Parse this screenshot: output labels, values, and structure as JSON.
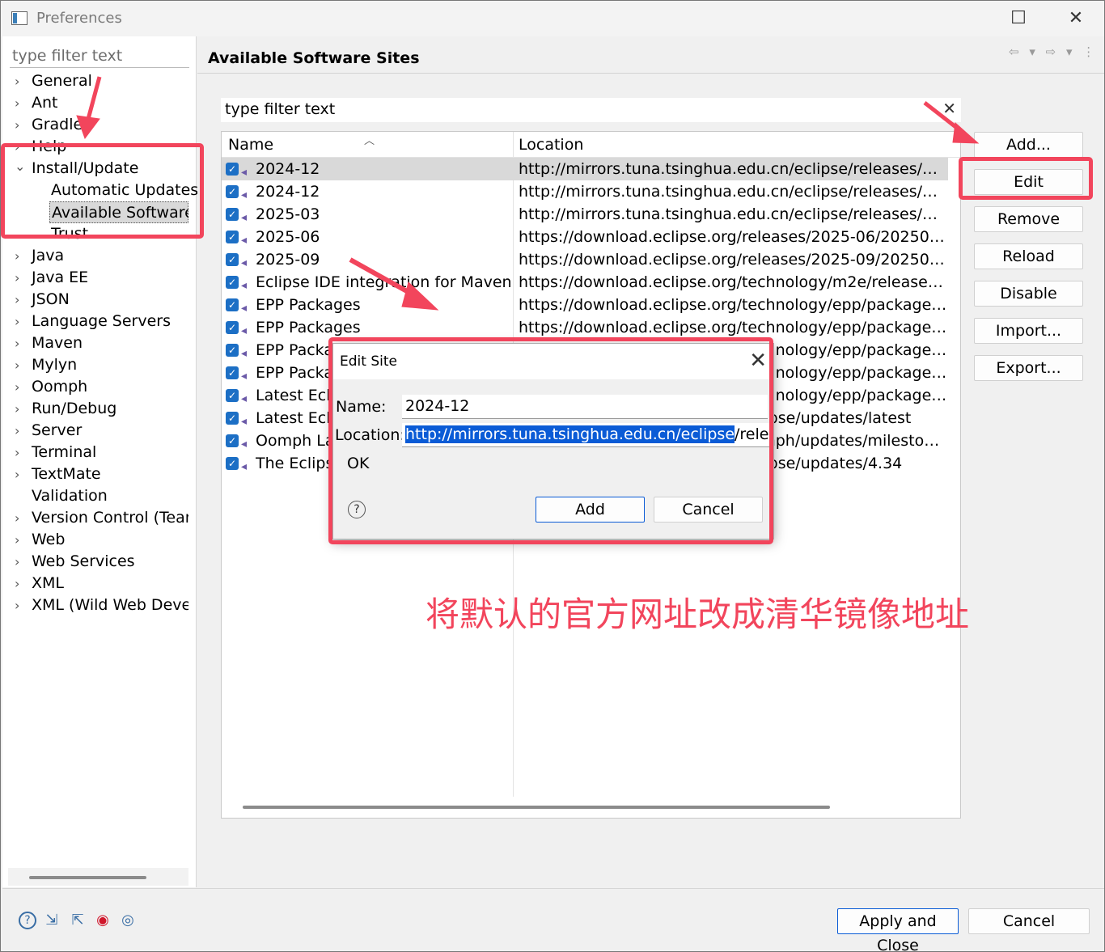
{
  "window": {
    "title": "Preferences",
    "maximize_glyph": "☐",
    "close_glyph": "✕"
  },
  "left": {
    "filter_placeholder": "type filter text",
    "tree": [
      {
        "label": "General",
        "chevron": "›"
      },
      {
        "label": "Ant",
        "chevron": "›"
      },
      {
        "label": "Gradle",
        "chevron": "›"
      },
      {
        "label": "Help",
        "chevron": "›"
      },
      {
        "label": "Install/Update",
        "chevron": "⌄"
      },
      {
        "label": "Automatic Updates",
        "chevron": ""
      },
      {
        "label": "Available Software Sites",
        "chevron": ""
      },
      {
        "label": "Trust",
        "chevron": ""
      },
      {
        "label": "Java",
        "chevron": "›"
      },
      {
        "label": "Java EE",
        "chevron": "›"
      },
      {
        "label": "JSON",
        "chevron": "›"
      },
      {
        "label": "Language Servers",
        "chevron": "›"
      },
      {
        "label": "Maven",
        "chevron": "›"
      },
      {
        "label": "Mylyn",
        "chevron": "›"
      },
      {
        "label": "Oomph",
        "chevron": "›"
      },
      {
        "label": "Run/Debug",
        "chevron": "›"
      },
      {
        "label": "Server",
        "chevron": "›"
      },
      {
        "label": "Terminal",
        "chevron": "›"
      },
      {
        "label": "TextMate",
        "chevron": "›"
      },
      {
        "label": "Validation",
        "chevron": ""
      },
      {
        "label": "Version Control (Team)",
        "chevron": "›"
      },
      {
        "label": "Web",
        "chevron": "›"
      },
      {
        "label": "Web Services",
        "chevron": "›"
      },
      {
        "label": "XML",
        "chevron": "›"
      },
      {
        "label": "XML (Wild Web Developer)",
        "chevron": "›"
      }
    ]
  },
  "main": {
    "heading": "Available Software Sites",
    "nav_icons": "⇦ ▾ ⇨ ▾ ⋮",
    "filter_text": "type filter text",
    "filter_clear": "✕",
    "columns": {
      "name": "Name",
      "location": "Location"
    },
    "rows": [
      {
        "name": "2024-12",
        "location": "http://mirrors.tuna.tsinghua.edu.cn/eclipse/releases/2024-..."
      },
      {
        "name": "2024-12",
        "location": "http://mirrors.tuna.tsinghua.edu.cn/eclipse/releases/2024-..."
      },
      {
        "name": "2025-03",
        "location": "http://mirrors.tuna.tsinghua.edu.cn/eclipse/releases/2025-..."
      },
      {
        "name": "2025-06",
        "location": "https://download.eclipse.org/releases/2025-06/202506111..."
      },
      {
        "name": "2025-09",
        "location": "https://download.eclipse.org/releases/2025-09/202509101..."
      },
      {
        "name": "Eclipse IDE integration for Maven",
        "location": "https://download.eclipse.org/technology/m2e/releases/lat..."
      },
      {
        "name": "EPP Packages",
        "location": "https://download.eclipse.org/technology/epp/packages/20..."
      },
      {
        "name": "EPP Packages",
        "location": "https://download.eclipse.org/technology/epp/packages/20..."
      },
      {
        "name": "EPP Packages",
        "location": "https://download.eclipse.org/technology/epp/packages/20..."
      },
      {
        "name": "EPP Packages",
        "location": "https://download.eclipse.org/technology/epp/packages/20..."
      },
      {
        "name": "Latest Eclipse",
        "location": "https://download.eclipse.org/technology/epp/packages/lat..."
      },
      {
        "name": "Latest Eclipse",
        "location": "https://download.eclipse.org/eclipse/updates/latest"
      },
      {
        "name": "Oomph Latest",
        "location": "https://download.eclipse.org/oomph/updates/milestone/la..."
      },
      {
        "name": "The Eclipse Project Updates",
        "location": "https://download.eclipse.org/eclipse/updates/4.34"
      }
    ],
    "buttons": {
      "add": "Add...",
      "edit": "Edit",
      "remove": "Remove",
      "reload": "Reload",
      "disable": "Disable",
      "import": "Import...",
      "export": "Export..."
    }
  },
  "dialog": {
    "title": "Edit Site",
    "name_label": "Name:",
    "name_value": "2024-12",
    "location_label": "Location:",
    "location_selected": "http://mirrors.tuna.tsinghua.edu.cn/eclipse",
    "location_rest": "/releases/",
    "status": "OK",
    "help_glyph": "?",
    "add_button": "Add",
    "cancel_button": "Cancel"
  },
  "footer": {
    "apply_close": "Apply and Close",
    "cancel": "Cancel"
  },
  "annotation": "将默认的官方网址改成清华镜像地址"
}
